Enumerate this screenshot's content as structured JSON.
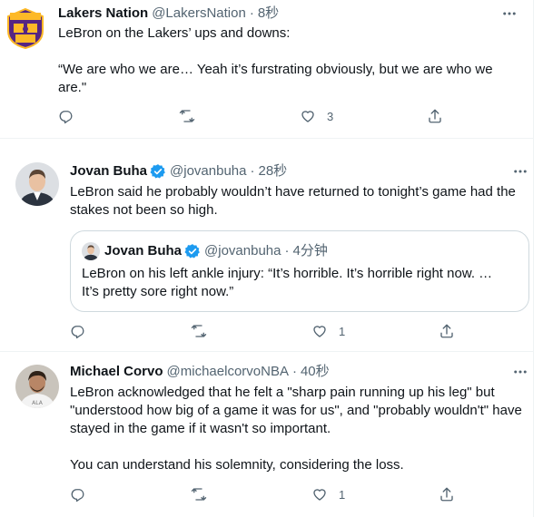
{
  "tweets": [
    {
      "name": "Lakers Nation",
      "handle": "@LakersNation",
      "separator": "·",
      "time": "8秒",
      "text": "LeBron on the Lakers’ ups and downs:\n\n“We are who we are… Yeah it’s furstrating obviously, but we are who we are.\"",
      "likes": "3",
      "verified": false
    },
    {
      "name": "Jovan Buha",
      "handle": "@jovanbuha",
      "separator": "·",
      "time": "28秒",
      "text": "LeBron said he probably wouldn’t have returned to tonight’s game had the stakes not been so high.",
      "likes": "1",
      "verified": true,
      "quote": {
        "name": "Jovan Buha",
        "handle": "@jovanbuha",
        "separator": "·",
        "time": "4分钟",
        "text": "LeBron on his left ankle injury: “It’s horrible. It’s horrible right now. … It’s pretty sore right now.”"
      }
    },
    {
      "name": "Michael Corvo",
      "handle": "@michaelcorvoNBA",
      "separator": "·",
      "time": "40秒",
      "text": "LeBron acknowledged that he felt a \"sharp pain running up his leg\" but \"understood how big of a game it was for us\", and \"probably wouldn't\" have stayed in the game if it wasn't so important.\n\nYou can understand his solemnity, considering the loss.",
      "likes": "1",
      "verified": false
    }
  ],
  "colors": {
    "text": "#0f1419",
    "muted": "#536471",
    "verified": "#1d9bf0",
    "border": "#cfd9de",
    "lakers_purple": "#552583",
    "lakers_gold": "#fdb927"
  },
  "icons": [
    "reply-icon",
    "retweet-icon",
    "like-icon",
    "share-icon",
    "more-icon",
    "verified-badge-icon"
  ]
}
